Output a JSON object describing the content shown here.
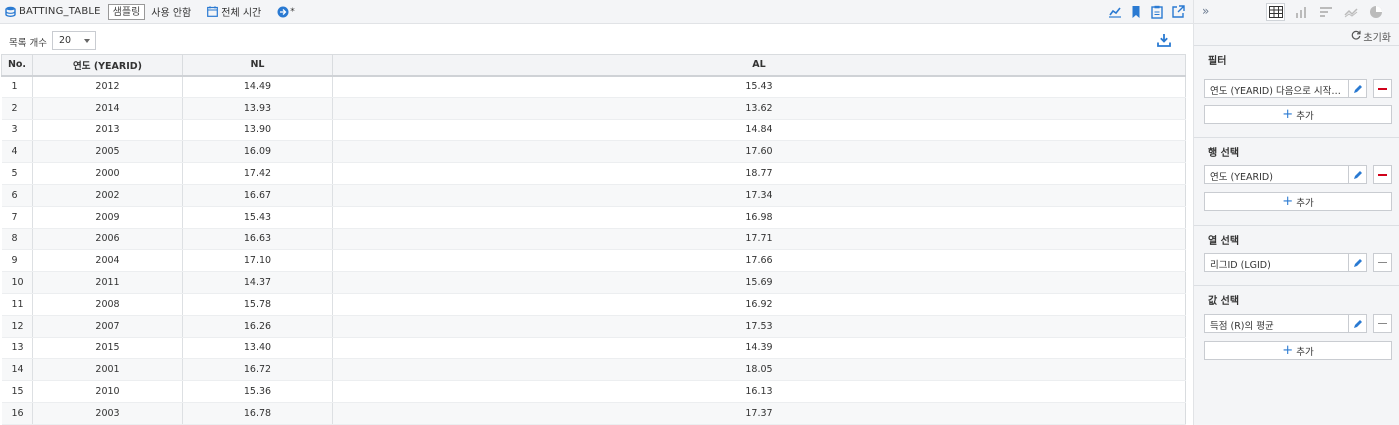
{
  "header": {
    "title": "BATTING_TABLE",
    "sample_label": "샘플링",
    "usage_label": "사용 안함",
    "time_label": "전체 시간",
    "star": "*"
  },
  "toolbar": {
    "count_label": "목록 개수",
    "count_value": "20"
  },
  "table": {
    "columns": [
      "No.",
      "연도 (YEARID)",
      "NL",
      "AL"
    ],
    "rows": [
      [
        "1",
        "2012",
        "14.49",
        "15.43"
      ],
      [
        "2",
        "2014",
        "13.93",
        "13.62"
      ],
      [
        "3",
        "2013",
        "13.90",
        "14.84"
      ],
      [
        "4",
        "2005",
        "16.09",
        "17.60"
      ],
      [
        "5",
        "2000",
        "17.42",
        "18.77"
      ],
      [
        "6",
        "2002",
        "16.67",
        "17.34"
      ],
      [
        "7",
        "2009",
        "15.43",
        "16.98"
      ],
      [
        "8",
        "2006",
        "16.63",
        "17.71"
      ],
      [
        "9",
        "2004",
        "17.10",
        "17.66"
      ],
      [
        "10",
        "2011",
        "14.37",
        "15.69"
      ],
      [
        "11",
        "2008",
        "15.78",
        "16.92"
      ],
      [
        "12",
        "2007",
        "16.26",
        "17.53"
      ],
      [
        "13",
        "2015",
        "13.40",
        "14.39"
      ],
      [
        "14",
        "2001",
        "16.72",
        "18.05"
      ],
      [
        "15",
        "2010",
        "15.36",
        "16.13"
      ],
      [
        "16",
        "2003",
        "16.78",
        "17.37"
      ]
    ]
  },
  "panel": {
    "reset_label": "초기화",
    "filter": {
      "title": "필터",
      "field": "연도 (YEARID) 다음으로 시작…",
      "add": "추가"
    },
    "rows": {
      "title": "행 선택",
      "field": "연도 (YEARID)",
      "add": "추가"
    },
    "cols": {
      "title": "열 선택",
      "field": "리그ID (LGID)"
    },
    "values": {
      "title": "값 선택",
      "field": "득점 (R)의 평균",
      "add": "추가"
    }
  },
  "colors": {
    "accent": "#2a7ad2",
    "delete": "#d0021b"
  }
}
